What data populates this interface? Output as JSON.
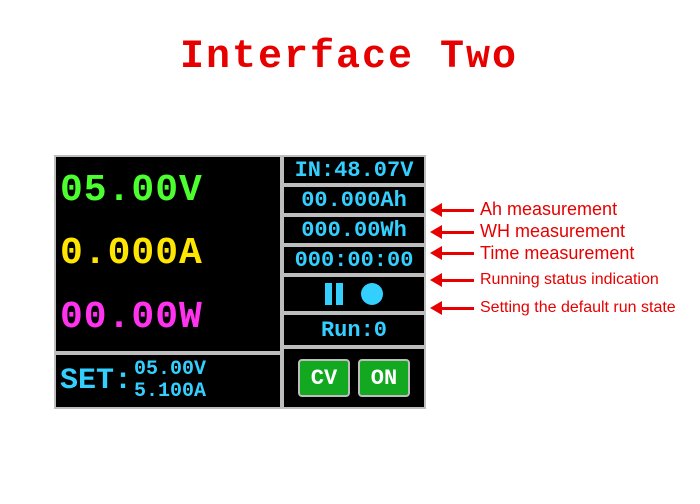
{
  "title": "Interface Two",
  "readouts": {
    "voltage": "05.00V",
    "current": "0.000A",
    "power": "00.00W"
  },
  "set": {
    "label": "SET:",
    "voltage": "05.00V",
    "current": "5.100A"
  },
  "right": {
    "in": "IN:48.07V",
    "ah": "00.000Ah",
    "wh": "000.00Wh",
    "time": "000:00:00",
    "run": "Run:0",
    "cv": "CV",
    "on": "ON"
  },
  "annotations": {
    "ah": "Ah measurement",
    "wh": "WH measurement",
    "time": "Time measurement",
    "status": "Running status indication",
    "run": "Setting the default run state"
  }
}
